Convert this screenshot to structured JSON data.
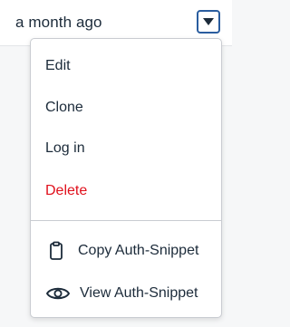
{
  "header": {
    "time_ago": "a month ago",
    "toggle_icon": "caret-down-icon"
  },
  "menu": {
    "items": [
      {
        "label": "Edit",
        "style": "normal"
      },
      {
        "label": "Clone",
        "style": "normal"
      },
      {
        "label": "Log in",
        "style": "normal"
      },
      {
        "label": "Delete",
        "style": "danger"
      },
      {
        "label": "Copy Auth-Snippet",
        "icon": "clipboard-icon"
      },
      {
        "label": "View Auth-Snippet",
        "icon": "eye-icon"
      }
    ]
  },
  "colors": {
    "text": "#1c2b3a",
    "danger": "#e0101c",
    "toggle_border": "#2a5d9f",
    "menu_border": "#c9ccd1"
  }
}
